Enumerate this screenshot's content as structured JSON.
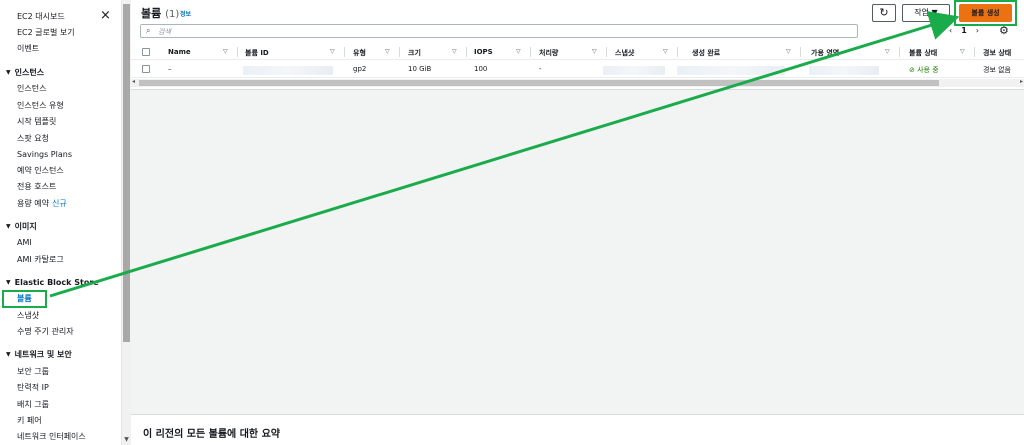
{
  "sidebar": {
    "links_top": [
      "EC2 대시보드",
      "EC2 글로벌 보기",
      "이벤트"
    ],
    "sections": [
      {
        "title": "인스턴스",
        "items": [
          "인스턴스",
          "인스턴스 유형",
          "시작 템플릿",
          "스팟 요청",
          "Savings Plans",
          "예약 인스턴스",
          "전용 호스트",
          "용량 예약"
        ]
      },
      {
        "title": "이미지",
        "items": [
          "AMI",
          "AMI 카탈로그"
        ]
      },
      {
        "title": "Elastic Block Store",
        "items": [
          "볼륨",
          "스냅샷",
          "수명 주기 관리자"
        ]
      },
      {
        "title": "네트워크 및 보안",
        "items": [
          "보안 그룹",
          "탄력적 IP",
          "배치 그룹",
          "키 페어",
          "네트워크 인터페이스"
        ]
      }
    ],
    "new_badge": "신규",
    "close_icon": "×"
  },
  "header": {
    "title": "볼륨",
    "count": "(1)",
    "info": "정보",
    "refresh_icon": "↻",
    "actions_label": "작업 ▼",
    "create_label": "볼륨 생성"
  },
  "search": {
    "icon": "⌕",
    "placeholder": "검색"
  },
  "pager": {
    "prev": "‹",
    "page": "1",
    "next": "›",
    "settings_icon": "⚙"
  },
  "table": {
    "columns": [
      "Name",
      "볼륨 ID",
      "유형",
      "크기",
      "IOPS",
      "처리량",
      "스냅샷",
      "생성 완료",
      "가용 영역",
      "볼륨 상태",
      "경보 상태"
    ],
    "rows": [
      {
        "name": "–",
        "type": "gp2",
        "size": "10 GiB",
        "iops": "100",
        "throughput": "-",
        "status": "사용 중",
        "alarm": "경보 없음"
      }
    ]
  },
  "summary": {
    "title": "이 리전의 모든 볼륨에 대한 요약"
  },
  "colors": {
    "accent": "#0073bb",
    "primary": "#ec7211",
    "highlight": "#1aab4b"
  }
}
